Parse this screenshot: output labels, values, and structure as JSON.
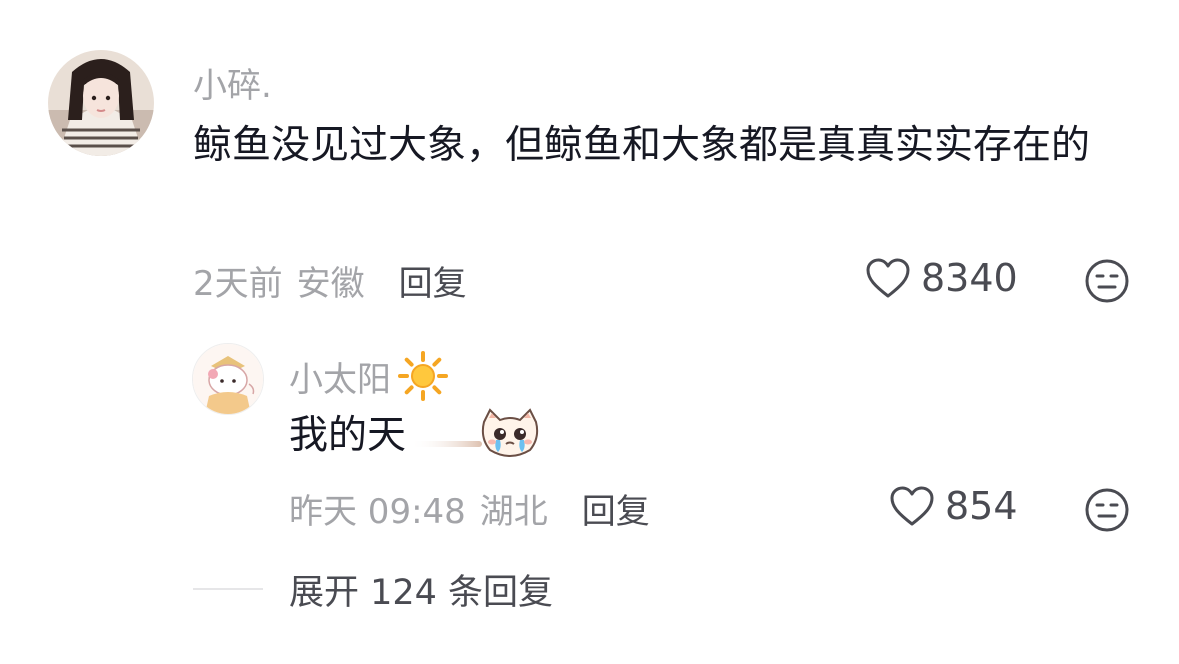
{
  "comment": {
    "username": "小碎.",
    "text": "鲸鱼没见过大象，但鲸鱼和大象都是真真实实存在的",
    "time": "2天前",
    "location": "安徽",
    "reply_label": "回复",
    "like_count": "8340"
  },
  "reply": {
    "username": "小太阳",
    "text": "我的天",
    "time": "昨天 09:48",
    "location": "湖北",
    "reply_label": "回复",
    "like_count": "854"
  },
  "expand_label": "展开 124 条回复",
  "icons": {
    "like": "heart-outline-icon",
    "dislike": "meh-face-icon",
    "sun": "sun-emoji-icon",
    "crying_cat": "crying-cat-emoji-icon"
  },
  "colors": {
    "primary_text": "#161823",
    "secondary_text": "#a3a4a8",
    "action_text": "#4a4b52"
  }
}
